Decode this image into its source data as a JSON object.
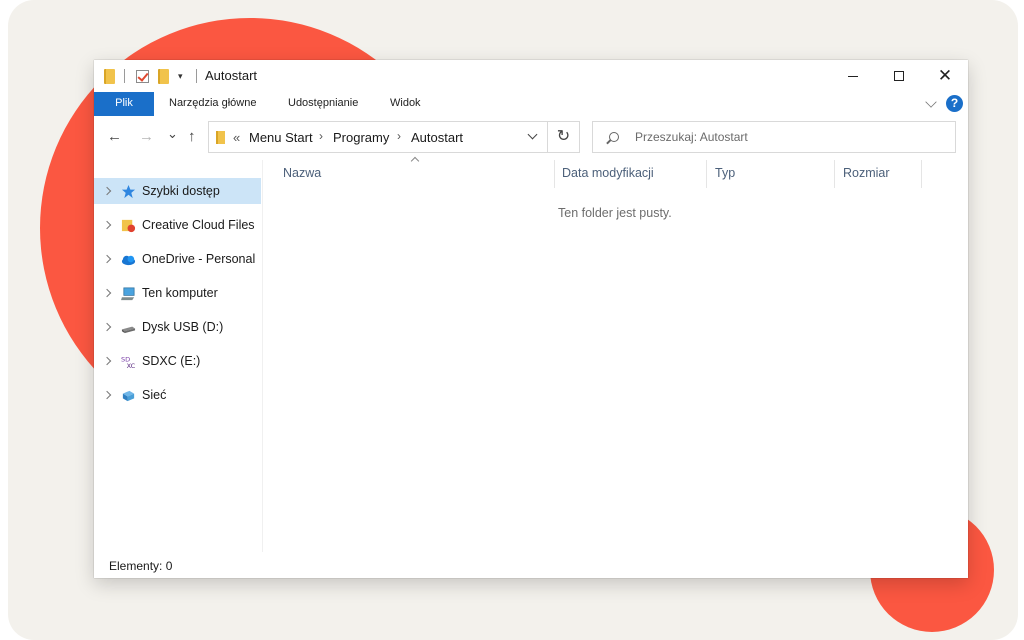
{
  "window": {
    "title": "Autostart",
    "controls": {
      "minimize": "minimize",
      "maximize": "maximize",
      "close": "close"
    }
  },
  "ribbon": {
    "tabs": [
      "Plik",
      "Narzędzia główne",
      "Udostępnianie",
      "Widok"
    ],
    "help_label": "?"
  },
  "address": {
    "overflow": "«",
    "breadcrumbs": [
      "Menu Start",
      "Programy",
      "Autostart"
    ],
    "refresh_glyph": "↻"
  },
  "search": {
    "placeholder": "Przeszukaj: Autostart"
  },
  "nav": {
    "back": "←",
    "forward": "→",
    "recent": "⌄",
    "up": "↑"
  },
  "sidebar": {
    "items": [
      {
        "label": "Szybki dostęp",
        "icon": "star-icon",
        "active": true
      },
      {
        "label": "Creative Cloud Files",
        "icon": "creative-cloud-icon",
        "active": false
      },
      {
        "label": "OneDrive - Personal",
        "icon": "onedrive-cloud-icon",
        "active": false
      },
      {
        "label": "Ten komputer",
        "icon": "computer-icon",
        "active": false
      },
      {
        "label": "Dysk USB (D:)",
        "icon": "usb-drive-icon",
        "active": false
      },
      {
        "label": "SDXC (E:)",
        "icon": "sd-card-icon",
        "active": false
      },
      {
        "label": "Sieć",
        "icon": "network-icon",
        "active": false
      }
    ]
  },
  "columns": {
    "name": "Nazwa",
    "modified": "Data modyfikacji",
    "type": "Typ",
    "size": "Rozmiar"
  },
  "content": {
    "empty_message": "Ten folder jest pusty."
  },
  "status": {
    "items_count": "Elementy: 0"
  },
  "colors": {
    "accent": "#1a6fc9",
    "blob": "#fb5741",
    "selection": "#cce4f7",
    "backdrop": "#f3f1ec"
  }
}
